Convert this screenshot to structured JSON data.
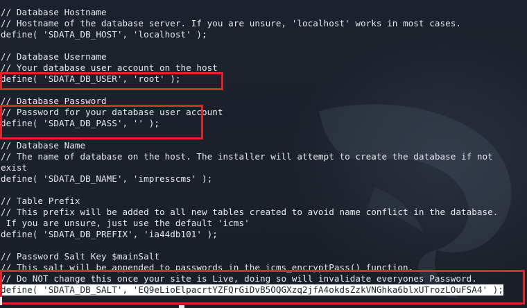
{
  "editor": {
    "lines": [
      "// Database Hostname",
      "// Hostname of the database server. If you are unsure, 'localhost' works in most cases.",
      "define( 'SDATA_DB_HOST', 'localhost' );",
      "",
      "// Database Username",
      "// Your database user account on the host",
      "define( 'SDATA_DB_USER', 'root' );",
      "",
      "// Database Password",
      "// Password for your database user account",
      "define( 'SDATA_DB_PASS', '' );",
      "",
      "// Database Name",
      "// The name of database on the host. The installer will attempt to create the database if not",
      "exist",
      "define( 'SDATA_DB_NAME', 'impresscms' );",
      "",
      "// Table Prefix",
      "// This prefix will be added to all new tables created to avoid name conflict in the database.",
      " If you are unsure, just use the default 'icms'",
      "define( 'SDATA_DB_PREFIX', 'ia44db101' );",
      "",
      "// Password Salt Key $mainSalt",
      "// This salt will be appended to passwords in the icms_encryptPass() function.",
      "// Do NOT change this once your site is Live, doing so will invalidate everyones Password.",
      "define( 'SDATA_DB_SALT', 'EQ9eLioElpacrtYZFQrGiDvB5OQGXzq2jfA4okdsZzkVNGhka6blxUTrozLOuFSA4' );"
    ],
    "selected_line_index": 25
  },
  "colors": {
    "background": "#1b212c",
    "text": "#e6e9ee",
    "highlight_border": "#e0242c"
  }
}
